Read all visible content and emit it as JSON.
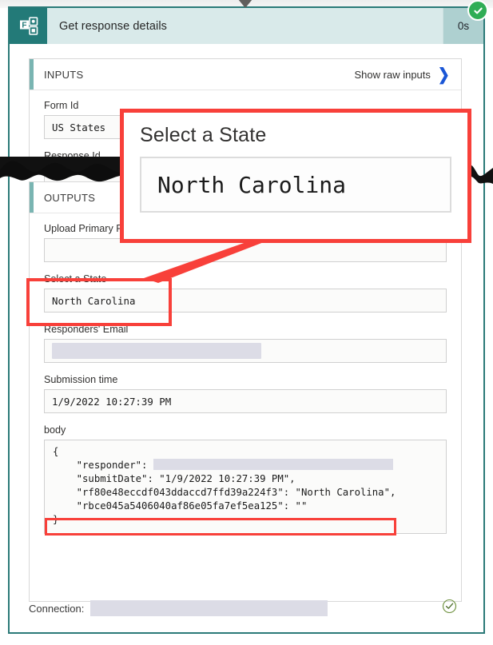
{
  "window": {
    "app_icon": "microsoft-forms-icon",
    "connector_arrow_icon": "arrow-down-icon"
  },
  "header": {
    "title": "Get response details",
    "duration": "0s",
    "status_icon": "success-check-icon"
  },
  "inputs_panel": {
    "title": "INPUTS",
    "raw_link_label": "Show raw inputs",
    "raw_link_icon": "chevron-right-icon",
    "fields": [
      {
        "label": "Form Id",
        "value": "US States"
      },
      {
        "label": "Response Id",
        "value": ""
      }
    ]
  },
  "outputs_panel": {
    "title": "OUTPUTS",
    "fields": [
      {
        "label": "Upload Primary Fi",
        "value": ""
      },
      {
        "label": "Select a State",
        "value": "North Carolina"
      },
      {
        "label": "Responders' Email",
        "value": ""
      },
      {
        "label": "Submission time",
        "value": "1/9/2022 10:27:39 PM"
      }
    ],
    "body_label": "body",
    "body_json_lines": [
      "{",
      "    \"responder\": ",
      "    \"submitDate\": \"1/9/2022 10:27:39 PM\",",
      "    \"rf80e48eccdf043ddaccd7ffd39a224f3\": \"North Carolina\",",
      "    \"rbce045a5406040af86e05fa7ef5ea125\": \"\"",
      "}"
    ],
    "body_json": {
      "responder": "",
      "submitDate": "1/9/2022 10:27:39 PM",
      "rf80e48eccdf043ddaccd7ffd39a224f3": "North Carolina",
      "rbce045a5406040af86e05fa7ef5ea125": ""
    }
  },
  "footer": {
    "connection_label": "Connection:",
    "connection_value": "",
    "status_icon": "check-circle-outline-icon"
  },
  "callout": {
    "label": "Select a State",
    "value": "North Carolina"
  },
  "colors": {
    "teal_border": "#2b7a78",
    "header_bg": "#d9eaea",
    "icon_bg": "#237a78",
    "duration_bg": "#aed0d0",
    "accent_bar": "#7ab5b2",
    "highlight_red": "#f8403a",
    "link_blue": "#1a56d6",
    "success_green": "#2fad55",
    "redaction_gray": "#dcdce6"
  }
}
